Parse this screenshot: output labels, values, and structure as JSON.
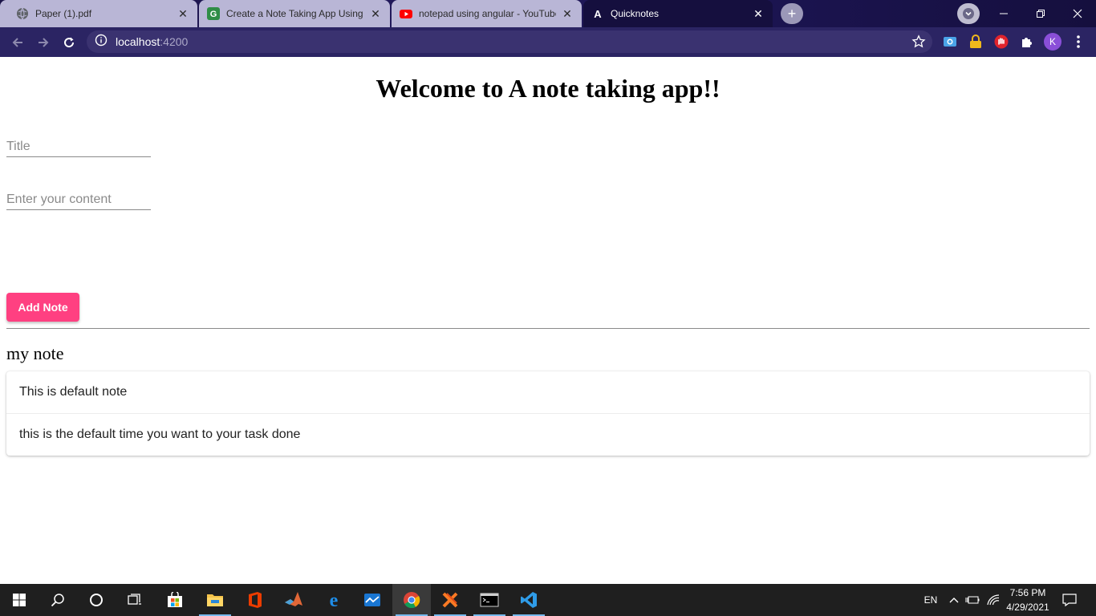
{
  "browser": {
    "tabs": [
      {
        "title": "Paper (1).pdf",
        "icon": "globe-icon",
        "active": false
      },
      {
        "title": "Create a Note Taking App Using",
        "icon": "geeksforgeeks-icon",
        "active": false
      },
      {
        "title": "notepad using angular - YouTube",
        "icon": "youtube-icon",
        "active": false
      },
      {
        "title": "Quicknotes",
        "icon": "angular-icon",
        "active": true
      }
    ],
    "address": {
      "host": "localhost",
      "port": ":4200"
    },
    "profile_initial": "K",
    "colors": {
      "frame": "#1a1347",
      "toolbar": "#2b2463",
      "omnibox": "#3a3270"
    }
  },
  "page": {
    "heading": "Welcome to A note taking app!!",
    "title_placeholder": "Title",
    "content_placeholder": "Enter your content",
    "add_button_label": "Add Note",
    "section_heading": "my note",
    "notes": [
      {
        "text": "This is default note"
      },
      {
        "text": "this is the default time you want to your task done"
      }
    ],
    "accent_color": "#ff4081"
  },
  "taskbar": {
    "apps": [
      "windows-start-icon",
      "search-icon",
      "cortana-icon",
      "task-view-icon",
      "store-icon",
      "file-explorer-icon",
      "office-icon",
      "matlab-icon",
      "edge-icon",
      "mail-icon",
      "chrome-icon",
      "xampp-icon",
      "terminal-icon",
      "vscode-icon"
    ],
    "language": "EN",
    "time": "7:56 PM",
    "date": "4/29/2021"
  }
}
